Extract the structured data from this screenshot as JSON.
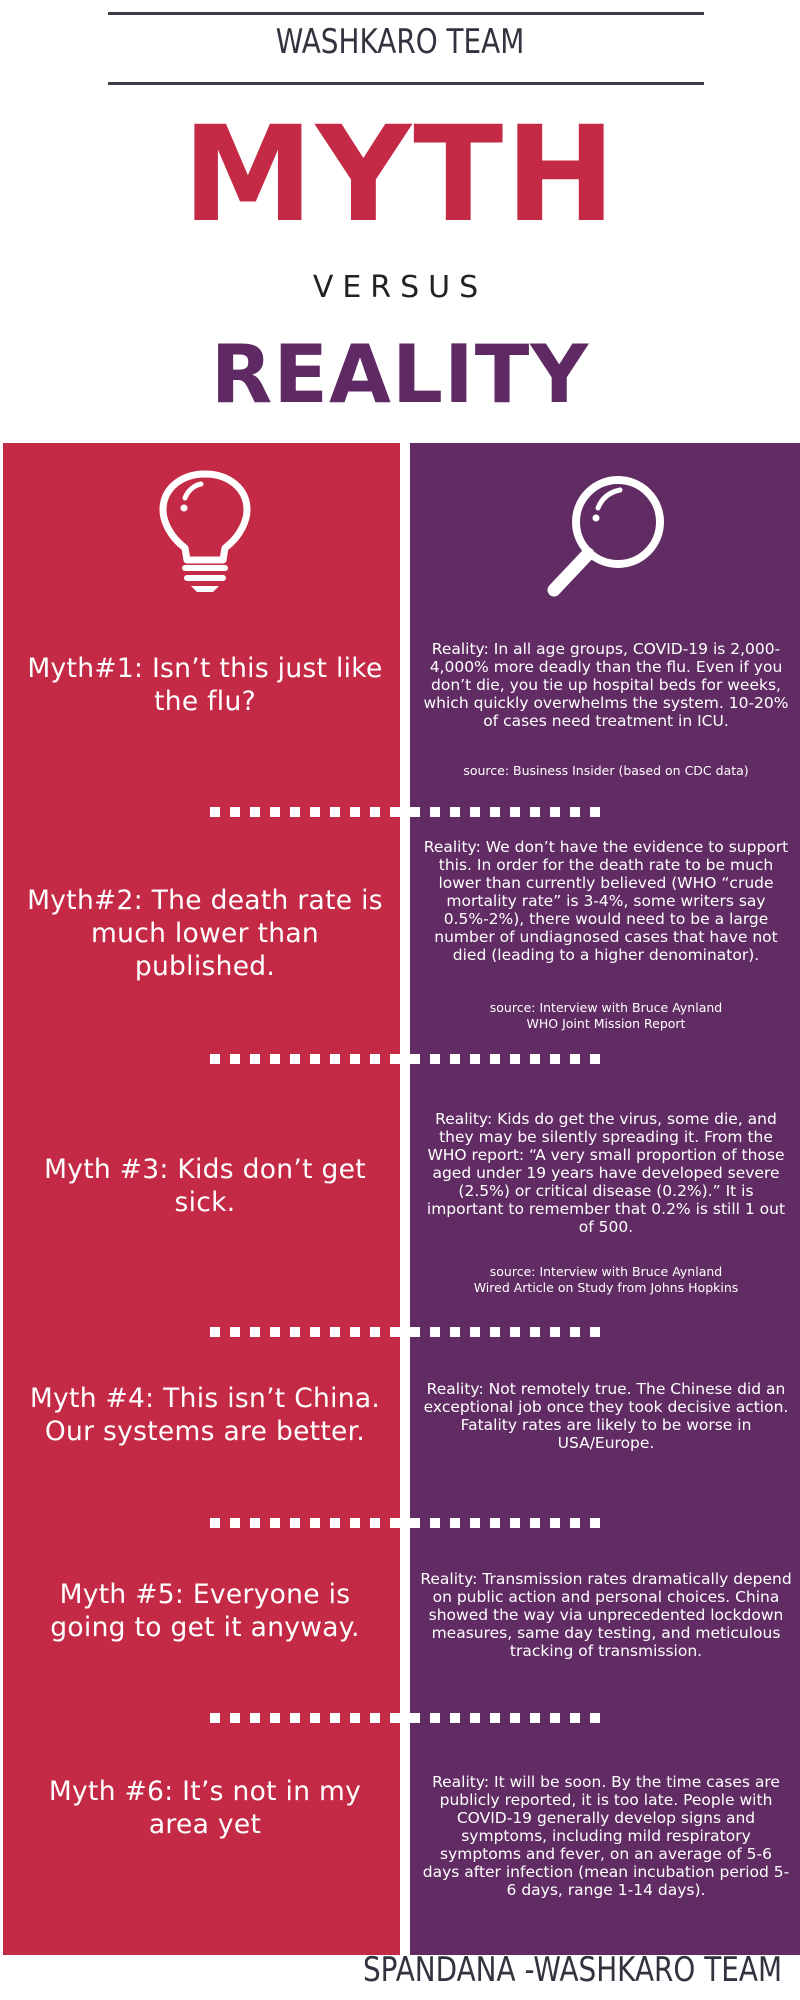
{
  "header": {
    "team": "WASHKARO TEAM",
    "myth": "MYTH",
    "versus": "VERSUS",
    "reality": "REALITY"
  },
  "icons": {
    "left": "lightbulb-icon",
    "right": "magnifying-glass-icon"
  },
  "colors": {
    "myth_red": "#c42a45",
    "reality_purple": "#612b63",
    "text_dark": "#33333f"
  },
  "items": [
    {
      "myth": "Myth#1: Isn’t this just like the flu?",
      "reality": "Reality: In all age groups, COVID-19 is 2,000-4,000% more deadly than the flu. Even if you don’t die, you tie up hospital beds for weeks, which quickly overwhelms the system. 10-20% of cases need treatment in ICU.",
      "source": "source: Business Insider (based on CDC data)"
    },
    {
      "myth": "Myth#2: The death rate is much lower than published.",
      "reality": "Reality: We don’t have the evidence to support this. In order for the death rate to be much lower than currently believed (WHO “crude mortality rate” is 3-4%, some writers say 0.5%-2%), there would need to be a large number of undiagnosed cases that have not died (leading to a higher denominator).",
      "source": "source: Interview with Bruce Aynland\nWHO Joint Mission Report"
    },
    {
      "myth": "Myth #3: Kids don’t get sick.",
      "reality": "Reality: Kids do get the virus, some die, and they may be silently spreading it. From the WHO report: “A very small proportion of those aged under 19 years have developed severe (2.5%) or critical disease (0.2%).” It is important to remember that 0.2% is still 1 out of 500.",
      "source": "source: Interview with Bruce Aynland\nWired Article on Study from Johns Hopkins"
    },
    {
      "myth": "Myth #4: This isn’t China. Our systems are better.",
      "reality": "Reality: Not remotely true. The Chinese did an exceptional job once they took decisive action. Fatality rates are likely to be worse in USA/Europe.",
      "source": ""
    },
    {
      "myth": "Myth #5: Everyone is going to get it anyway.",
      "reality": "Reality: Transmission rates dramatically depend on public action and personal choices. China showed the way via unprecedented lockdown measures, same day testing, and meticulous tracking of transmission.",
      "source": ""
    },
    {
      "myth": "Myth #6: It’s not in my area yet",
      "reality": "Reality: It will be soon. By the time cases are publicly reported, it is too late. People with COVID-19 generally develop signs and symptoms, including mild respiratory symptoms and fever, on an average of 5-6 days after infection (mean incubation period 5-6 days, range 1-14 days).",
      "source": ""
    }
  ],
  "footer": "SPANDANA -WASHKARO TEAM"
}
